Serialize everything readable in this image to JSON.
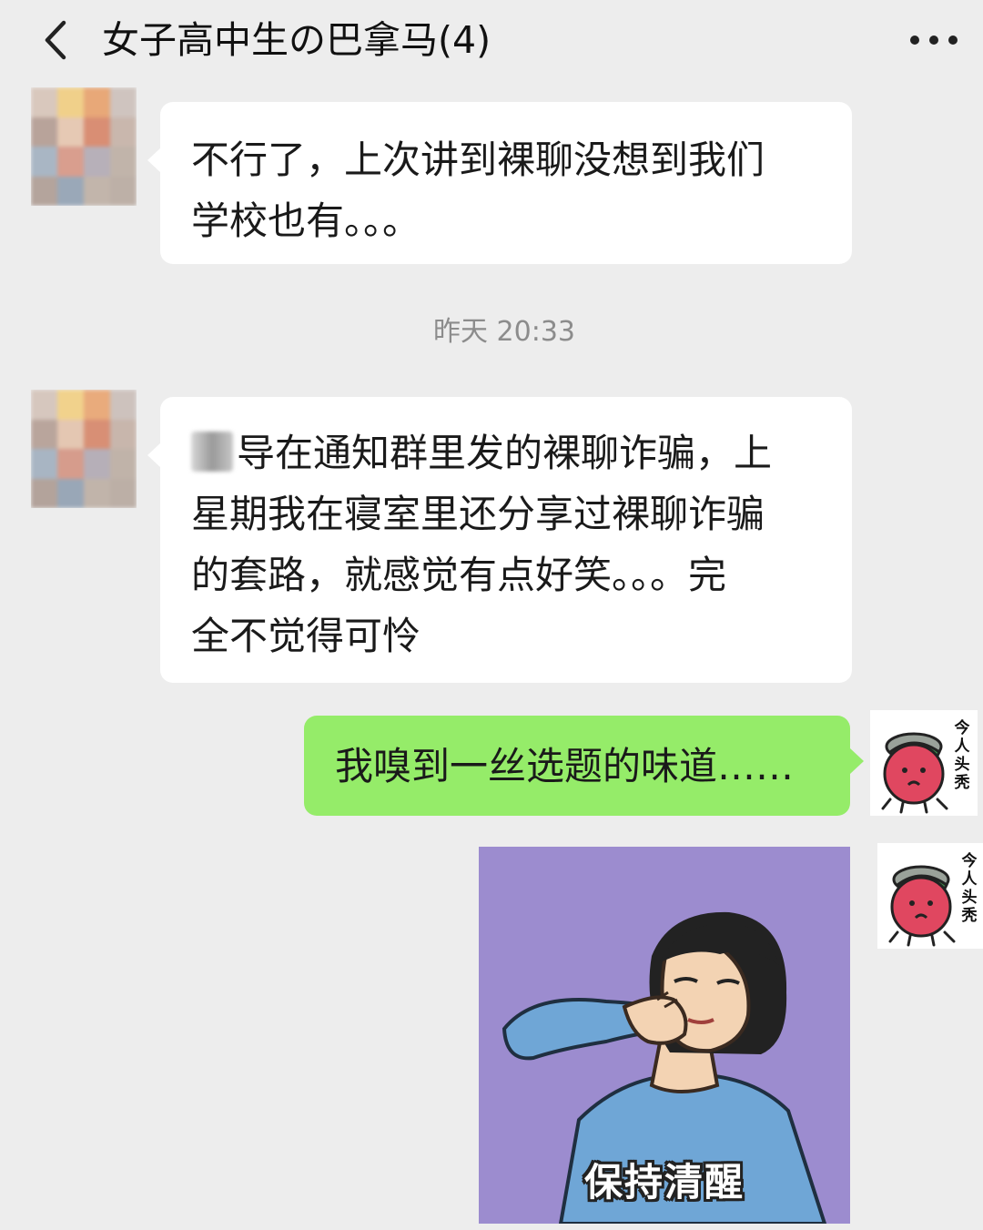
{
  "header": {
    "title": "女子高中生の巴拿马(4)",
    "back_icon": "chevron-left-icon",
    "more_icon": "more-dots-icon"
  },
  "messages": [
    {
      "sender": "other",
      "lines": [
        "不行了，上次讲到裸聊没想到我们",
        "学校也有。。。"
      ]
    },
    {
      "type": "timestamp",
      "text": "昨天 20:33"
    },
    {
      "sender": "other",
      "lines": [
        "导在通知群里发的裸聊诈骗，上",
        "星期我在寝室里还分享过裸聊诈骗",
        "的套路，就感觉有点好笑。。。完",
        "全不觉得可怜"
      ]
    },
    {
      "sender": "me",
      "lines": [
        "我嗅到一丝选题的味道……"
      ]
    },
    {
      "sender": "me",
      "type": "image",
      "caption": "保持清醒"
    }
  ],
  "sticker_avatar_text": "今人头秃",
  "colors": {
    "background": "#ededed",
    "bubble_other": "#ffffff",
    "bubble_me": "#95ec69",
    "meme_bg": "#9c8ccf"
  }
}
